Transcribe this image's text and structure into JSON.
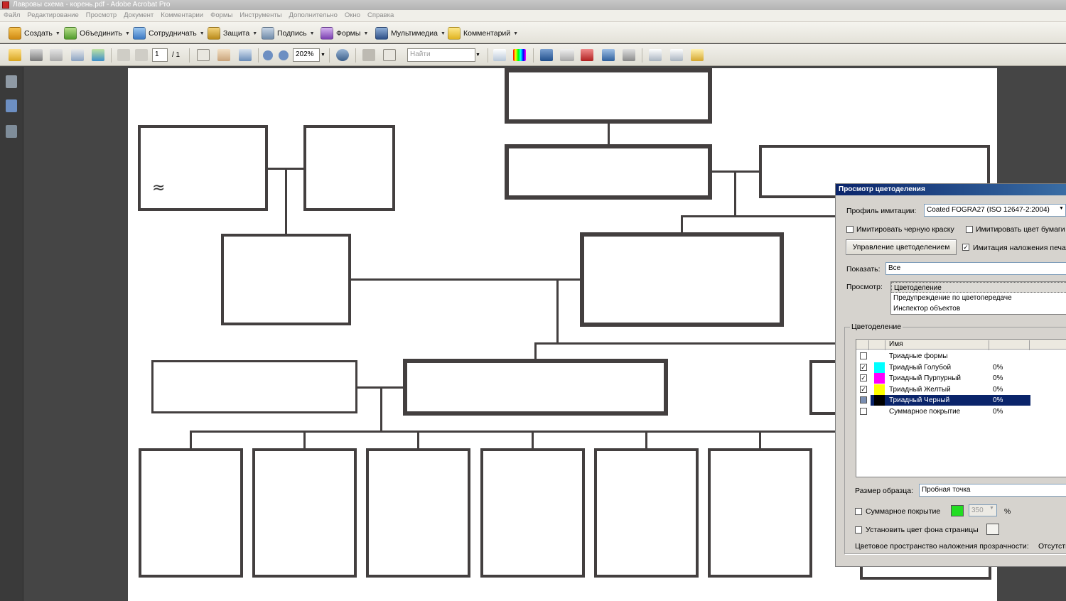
{
  "window": {
    "title": "Лавровы схема - корень.pdf - Adobe Acrobat Pro"
  },
  "menu": [
    "Файл",
    "Редактирование",
    "Просмотр",
    "Документ",
    "Комментарии",
    "Формы",
    "Инструменты",
    "Дополнительно",
    "Окно",
    "Справка"
  ],
  "toolbar1": {
    "create": "Создать",
    "combine": "Объединить",
    "collaborate": "Сотрудничать",
    "secure": "Защита",
    "sign": "Подпись",
    "forms": "Формы",
    "multimedia": "Мультимедиа",
    "comment": "Комментарий"
  },
  "toolbar2": {
    "page_current": "1",
    "page_total": "/ 1",
    "zoom": "202%",
    "search_placeholder": "Найти"
  },
  "page_content": {
    "approx_symbol": "≈"
  },
  "dialog": {
    "title": "Просмотр цветоделения",
    "profile_label": "Профиль имитации:",
    "profile_value": "Coated FOGRA27 (ISO 12647-2:2004)",
    "sim_black_ink": "Имитировать черную краску",
    "sim_paper_color": "Имитировать цвет бумаги",
    "manage_button": "Управление цветоделением",
    "sim_overprint": "Имитация наложения печати",
    "show_label": "Показать:",
    "show_value": "Все",
    "preview_label": "Просмотр:",
    "preview_options": [
      "Цветоделение",
      "Предупреждение по цветопередаче",
      "Инспектор объектов"
    ],
    "separations_group": "Цветоделение",
    "table_header": {
      "name": "Имя"
    },
    "separations": [
      {
        "name": "Триадные формы",
        "percent": "",
        "color": "",
        "checked": false
      },
      {
        "name": "Триадный Голубой",
        "percent": "0%",
        "color": "#00ffff",
        "checked": true
      },
      {
        "name": "Триадный Пурпурный",
        "percent": "0%",
        "color": "#ff00ff",
        "checked": true
      },
      {
        "name": "Триадный Желтый",
        "percent": "0%",
        "color": "#ffff00",
        "checked": true
      },
      {
        "name": "Триадный Черный",
        "percent": "0%",
        "color": "#000000",
        "checked": true,
        "selected": true
      },
      {
        "name": "Суммарное покрытие",
        "percent": "0%",
        "color": "",
        "checked": false
      }
    ],
    "sample_size_label": "Размер образца:",
    "sample_size_value": "Пробная точка",
    "total_coverage_label": "Суммарное покрытие",
    "total_coverage_value": "350",
    "percent_sign": "%",
    "page_bg_label": "Установить цвет фона страницы",
    "transparency_label": "Цветовое пространство наложения прозрачности:",
    "transparency_value": "Отсутств"
  }
}
